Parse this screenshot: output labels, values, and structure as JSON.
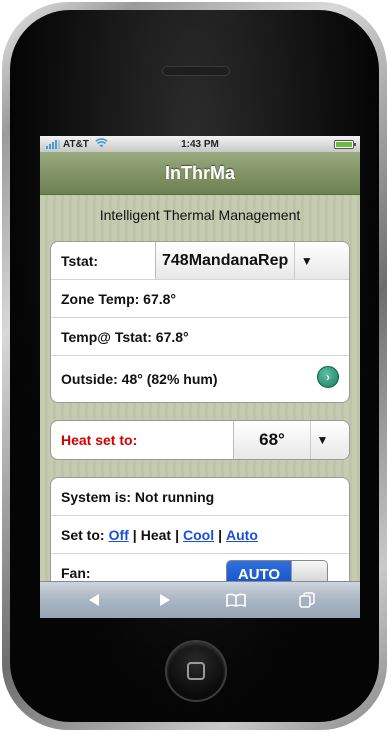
{
  "status_bar": {
    "carrier": "AT&T",
    "time": "1:43 PM"
  },
  "app": {
    "title": "InThrMa",
    "subtitle": "Intelligent Thermal Management"
  },
  "thermostat_group": {
    "tstat_label": "Tstat:",
    "tstat_value": "748MandanaRep",
    "zone_temp": "Zone Temp: 67.8°",
    "temp_at_tstat": "Temp@ Tstat: 67.8°",
    "outside": "Outside: 48° (82% hum)"
  },
  "setpoint_group": {
    "label": "Heat set to:",
    "value": "68°",
    "label_color": "#d40000"
  },
  "system_group": {
    "status": "System is: Not running",
    "set_to_label": "Set to:",
    "modes": [
      "Off",
      "Heat",
      "Cool",
      "Auto"
    ],
    "active_mode": "Heat",
    "fan_label": "Fan:",
    "fan_value": "AUTO"
  },
  "icons": {
    "go": "chevron-right-circle-icon",
    "dropdown": "triangle-down-icon",
    "back": "back-arrow-icon",
    "forward": "forward-arrow-icon",
    "bookmarks": "book-icon",
    "pages": "pages-icon"
  },
  "colors": {
    "title_bar": "#7e9263",
    "link": "#1a4fd6",
    "toggle_on": "#1552c4"
  }
}
